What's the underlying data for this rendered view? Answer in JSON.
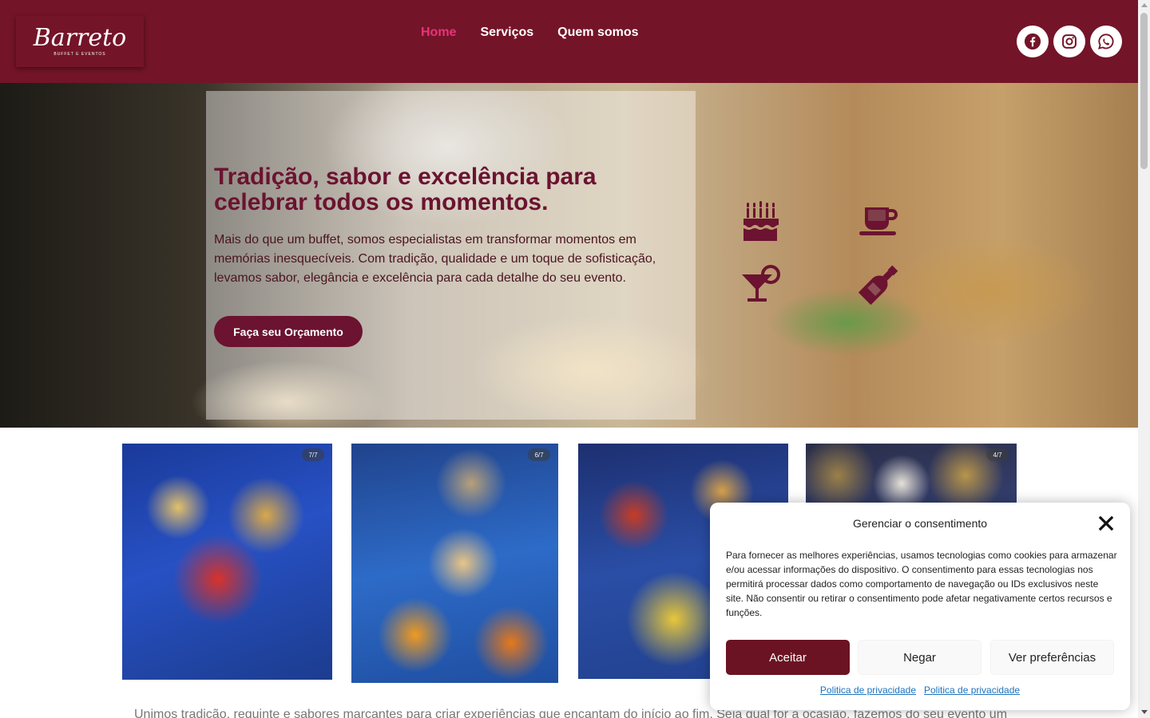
{
  "header": {
    "logo_text": "Barreto",
    "logo_subtext": "BUFFET E EVENTOS",
    "nav": [
      {
        "label": "Home",
        "active": true
      },
      {
        "label": "Serviços",
        "active": false
      },
      {
        "label": "Quem somos",
        "active": false
      }
    ],
    "socials": [
      "facebook-icon",
      "instagram-icon",
      "whatsapp-icon"
    ]
  },
  "hero": {
    "title": "Tradição, sabor e excelência para celebrar todos os momentos.",
    "text": "Mais do que um buffet, somos especialistas em transformar momentos em memórias inesquecíveis. Com tradição, qualidade e um toque de sofisticação, levamos sabor, elegância e excelência para cada detalhe do seu evento.",
    "cta_label": "Faça seu Orçamento",
    "icons": [
      "cake-icon",
      "coffee-cup-icon",
      "cocktail-icon",
      "wine-bottle-icon"
    ]
  },
  "gallery": {
    "counters": [
      "7/7",
      "6/7",
      "",
      "4/7"
    ]
  },
  "intro_text": "Unimos tradição, requinte e sabores marcantes para criar experiências que encantam do início ao fim. Seja qual for a ocasião, fazemos do seu evento um",
  "consent": {
    "title": "Gerenciar o consentimento",
    "text": "Para fornecer as melhores experiências, usamos tecnologias como cookies para armazenar e/ou acessar informações do dispositivo. O consentimento para essas tecnologias nos permitirá processar dados como comportamento de navegação ou IDs exclusivos neste site. Não consentir ou retirar o consentimento pode afetar negativamente certos recursos e funções.",
    "accept_label": "Aceitar",
    "deny_label": "Negar",
    "prefs_label": "Ver preferências",
    "links": [
      "Politica de privacidade",
      "Politica de privacidade"
    ]
  },
  "colors": {
    "brand": "#741428",
    "accent": "#e5357a",
    "button": "#6b1330"
  }
}
